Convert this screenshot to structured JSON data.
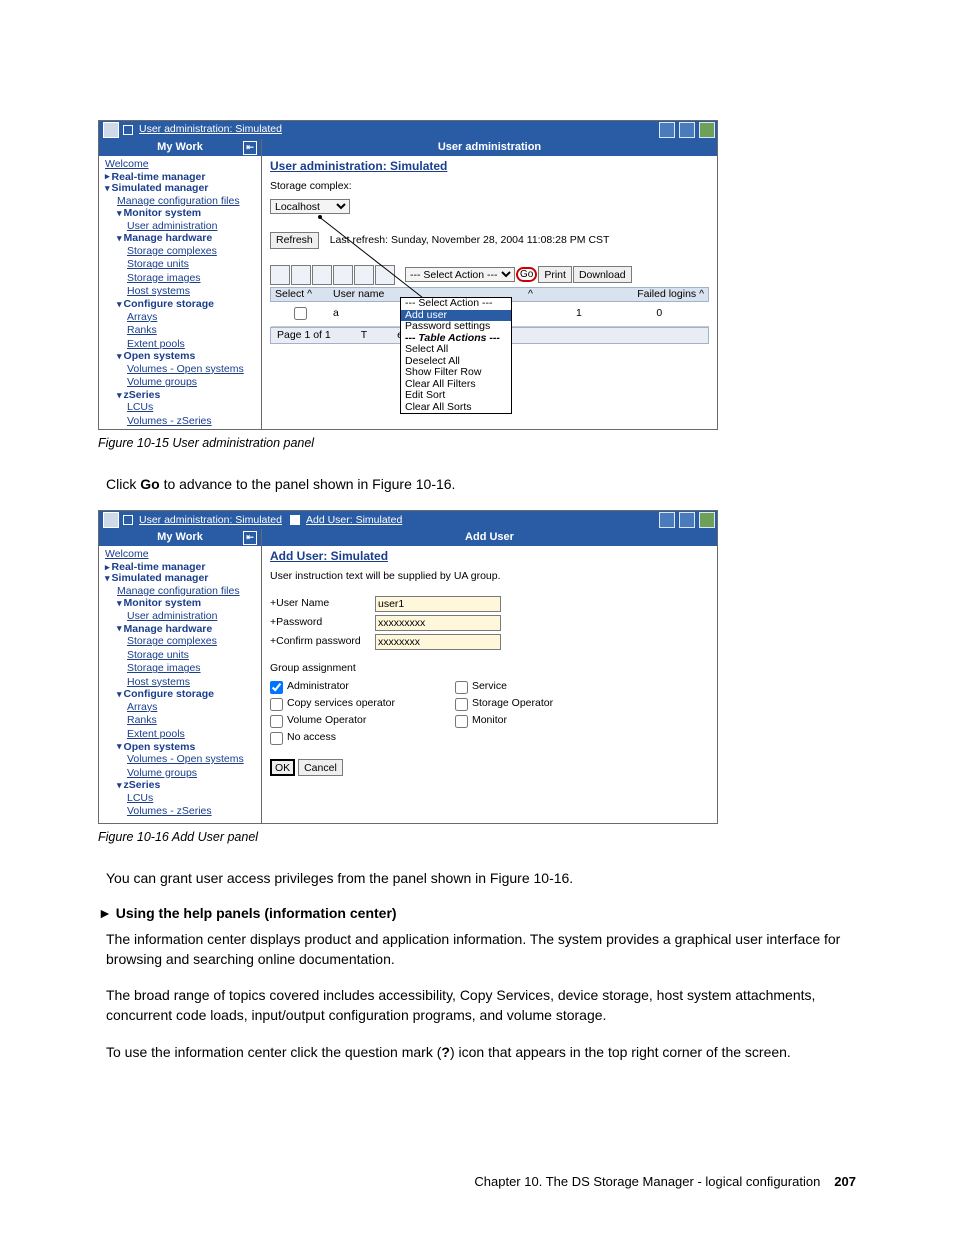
{
  "fig1": {
    "caption": "Figure 10-15   User administration panel",
    "titlebarCrumb": "User administration: Simulated",
    "navHeader": "My Work",
    "mainHeader": "User administration",
    "pageTitle": "User administration: Simulated",
    "storageComplexLabel": "Storage complex:",
    "storageComplexValue": "Localhost",
    "refresh": "Refresh",
    "lastRefresh": "Last refresh: Sunday, November 28, 2004 11:08:28 PM CST",
    "actionPlaceholder": "--- Select Action ---",
    "go": "Go",
    "print": "Print",
    "download": "Download",
    "th": {
      "select": "Select ^",
      "user": "User name",
      "failed": "Failed logins ^"
    },
    "row": {
      "user": "a",
      "status": "^",
      "n": "1",
      "failed": "0"
    },
    "pageOf": "Page 1 of 1",
    "totSel": "ed: 1    Selected: 0",
    "dd": {
      "top": "--- Select Action ---",
      "add": "Add user",
      "pw": "Password settings",
      "ta": "--- Table Actions ---",
      "sa": "Select All",
      "da": "Deselect All",
      "sfr": "Show Filter Row",
      "caf": "Clear All Filters",
      "es": "Edit Sort",
      "cas": "Clear All Sorts"
    }
  },
  "caption1After": "Click Go to advance to the panel shown in Figure 10-16.",
  "caption1AfterBold": "Go",
  "fig2": {
    "caption": "Figure 10-16   Add User panel",
    "titlebarCrumb1": "User administration: Simulated",
    "titlebarCrumb2": "Add User: Simulated",
    "navHeader": "My Work",
    "mainHeader": "Add User",
    "pageTitle": "Add User: Simulated",
    "instr": "User instruction text will be supplied by UA group.",
    "userLabel": "+User Name",
    "userValue": "user1",
    "pwLabel": "+Password",
    "pwValue": "xxxxxxxxx",
    "cpwLabel": "+Confirm password",
    "cpwValue": "xxxxxxxx",
    "grpLabel": "Group assignment",
    "roles": {
      "admin": "Administrator",
      "cso": "Copy services operator",
      "vo": "Volume Operator",
      "na": "No access",
      "svc": "Service",
      "so": "Storage Operator",
      "mon": "Monitor"
    },
    "ok": "OK",
    "cancel": "Cancel"
  },
  "nav": {
    "welcome": "Welcome",
    "rtm": "Real-time manager",
    "sim": "Simulated manager",
    "mcf": "Manage configuration files",
    "ms": "Monitor system",
    "ua": "User administration",
    "mh": "Manage hardware",
    "sc": "Storage complexes",
    "su": "Storage units",
    "si": "Storage images",
    "hs": "Host systems",
    "cs": "Configure storage",
    "ar": "Arrays",
    "rk": "Ranks",
    "ep": "Extent pools",
    "os": "Open systems",
    "vos": "Volumes - Open systems",
    "vg": "Volume groups",
    "zs": "zSeries",
    "lcu": "LCUs",
    "vzs": "Volumes - zSeries"
  },
  "afterFig2": "You can grant user access privileges from the panel shown in Figure 10-16.",
  "helpHeading": "Using the help panels (information center)",
  "para1": "The information center displays product and application information. The system provides a graphical user interface for browsing and searching online documentation.",
  "para2": "The broad range of topics covered includes accessibility, Copy Services, device storage, host system attachments, concurrent code loads, input/output configuration programs, and volume storage.",
  "para3a": "To use the information center click the question mark (",
  "para3b": "?",
  "para3c": ") icon that appears in the top right corner of the screen.",
  "footer": {
    "chapter": "Chapter 10. The DS Storage Manager - logical configuration",
    "page": "207"
  }
}
